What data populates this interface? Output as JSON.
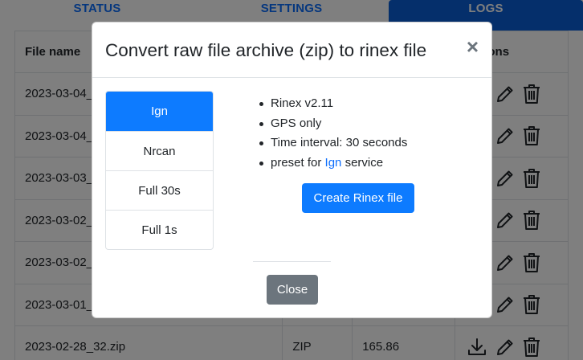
{
  "tabs": [
    {
      "label": "STATUS"
    },
    {
      "label": "SETTINGS"
    },
    {
      "label": "LOGS"
    }
  ],
  "table": {
    "headers": {
      "file_name": "File name",
      "actions": "Actions"
    },
    "rows": [
      {
        "file_name": "2023-03-04_",
        "type": "",
        "size": ""
      },
      {
        "file_name": "2023-03-04_",
        "type": "",
        "size": ""
      },
      {
        "file_name": "2023-03-03_",
        "type": "",
        "size": ""
      },
      {
        "file_name": "2023-03-02_",
        "type": "",
        "size": ""
      },
      {
        "file_name": "2023-03-02_",
        "type": "",
        "size": ""
      },
      {
        "file_name": "2023-03-01_",
        "type": "",
        "size": ""
      },
      {
        "file_name": "2023-02-28_32.zip",
        "type": "ZIP",
        "size": "165.86"
      }
    ]
  },
  "modal": {
    "title": "Convert raw file archive (zip) to rinex file",
    "close_symbol": "×",
    "presets": [
      {
        "label": "Ign",
        "active": true
      },
      {
        "label": "Nrcan",
        "active": false
      },
      {
        "label": "Full 30s",
        "active": false
      },
      {
        "label": "Full 1s",
        "active": false
      }
    ],
    "info": {
      "line1": "Rinex v2.11",
      "line2": "GPS only",
      "line3": "Time interval: 30 seconds",
      "line4_prefix": "preset for",
      "line4_service": "Ign",
      "line4_suffix": "service"
    },
    "create_button": "Create Rinex file",
    "close_button": "Close"
  },
  "colors": {
    "primary": "#0d7bff",
    "secondary": "#6c757d",
    "tab_active": "#0b5ed7"
  }
}
